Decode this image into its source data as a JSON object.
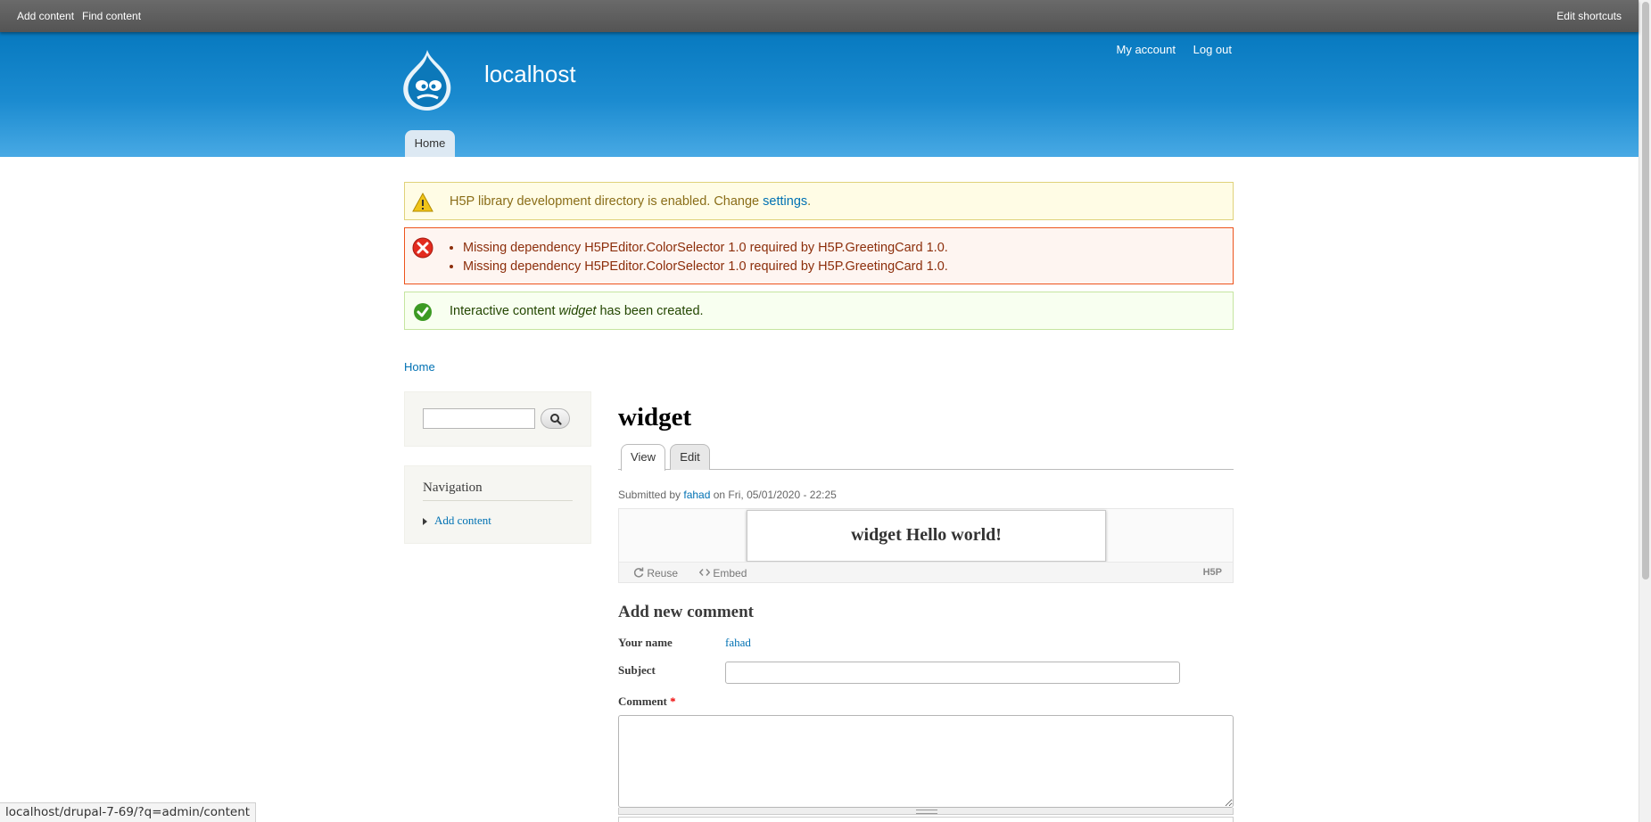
{
  "toolbar": {
    "add_content": "Add content",
    "find_content": "Find content",
    "edit_shortcuts": "Edit shortcuts"
  },
  "header": {
    "site_name": "localhost",
    "my_account": "My account",
    "log_out": "Log out",
    "home_tab": "Home"
  },
  "messages": {
    "warning": {
      "text": "H5P library development directory is enabled. Change ",
      "link": "settings",
      "suffix": "."
    },
    "errors": [
      "Missing dependency H5PEditor.ColorSelector 1.0 required by H5P.GreetingCard 1.0.",
      "Missing dependency H5PEditor.ColorSelector 1.0 required by H5P.GreetingCard 1.0."
    ],
    "status": {
      "prefix": "Interactive content ",
      "title": "widget",
      "suffix": " has been created."
    }
  },
  "breadcrumb": "Home",
  "sidebar": {
    "search_value": "",
    "navigation_title": "Navigation",
    "nav_items": [
      "Add content"
    ]
  },
  "node": {
    "title": "widget",
    "tabs": [
      "View",
      "Edit"
    ],
    "submitted_prefix": "Submitted by ",
    "author": "fahad",
    "submitted_suffix": " on Fri, 05/01/2020 - 22:25",
    "h5p_content": "widget Hello world!",
    "reuse": "Reuse",
    "embed": "Embed",
    "h5p_logo": "H5P"
  },
  "comment_form": {
    "title": "Add new comment",
    "name_label": "Your name",
    "name_value": "fahad",
    "subject_label": "Subject",
    "subject_value": "",
    "comment_label": "Comment",
    "required_mark": "*",
    "comment_value": ""
  },
  "status_bar_url": "localhost/drupal-7-69/?q=admin/content",
  "colors": {
    "header_blue": "#0779bf",
    "link": "#0071b3",
    "warning_bg": "#fffce5",
    "error_border": "#ed541d",
    "status_bg": "#f8fff0"
  }
}
